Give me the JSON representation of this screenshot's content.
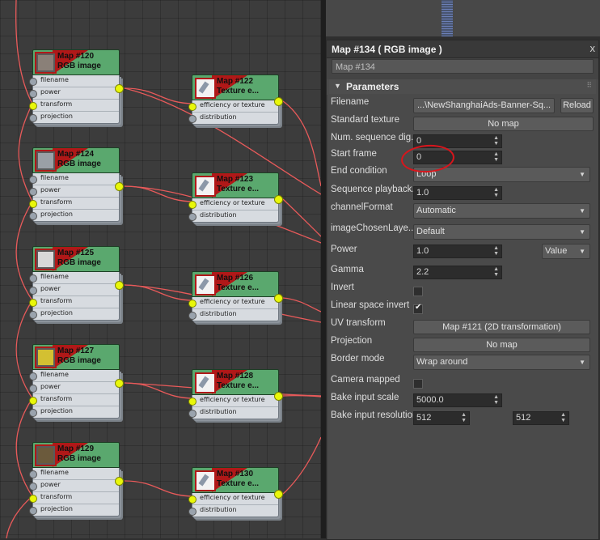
{
  "graph": {
    "nodes": [
      {
        "key": "n120",
        "title": "Map #120",
        "subtitle": "RGB image",
        "thumb": "#8a8078",
        "ports": [
          "filename",
          "power",
          "transform",
          "projection"
        ]
      },
      {
        "key": "n124",
        "title": "Map #124",
        "subtitle": "RGB image",
        "thumb": "#9aa0a6",
        "ports": [
          "filename",
          "power",
          "transform",
          "projection"
        ]
      },
      {
        "key": "n125",
        "title": "Map #125",
        "subtitle": "RGB image",
        "thumb": "#d8d8d8",
        "ports": [
          "filename",
          "power",
          "transform",
          "projection"
        ]
      },
      {
        "key": "n127",
        "title": "Map #127",
        "subtitle": "RGB image",
        "thumb": "#d3c032",
        "ports": [
          "filename",
          "power",
          "transform",
          "projection"
        ]
      },
      {
        "key": "n129",
        "title": "Map #129",
        "subtitle": "RGB image",
        "thumb": "#6b5a3c",
        "ports": [
          "filename",
          "power",
          "transform",
          "projection"
        ]
      },
      {
        "key": "n122",
        "title": "Map #122",
        "subtitle": "Texture e...",
        "ports": [
          "efficiency or texture",
          "distribution"
        ]
      },
      {
        "key": "n123",
        "title": "Map #123",
        "subtitle": "Texture e...",
        "ports": [
          "efficiency or texture",
          "distribution"
        ]
      },
      {
        "key": "n126",
        "title": "Map #126",
        "subtitle": "Texture e...",
        "ports": [
          "efficiency or texture",
          "distribution"
        ]
      },
      {
        "key": "n128",
        "title": "Map #128",
        "subtitle": "Texture e...",
        "ports": [
          "efficiency or texture",
          "distribution"
        ]
      },
      {
        "key": "n130",
        "title": "Map #130",
        "subtitle": "Texture e...",
        "ports": [
          "efficiency or texture",
          "distribution"
        ]
      }
    ],
    "wire_color": "#e85a5a"
  },
  "panel": {
    "title": "Map #134  ( RGB image )",
    "close": "x",
    "name": "Map #134",
    "rollout": "Parameters",
    "rows": {
      "filename": {
        "label": "Filename",
        "value": "...\\NewShanghaiAds-Banner-Sq...",
        "reload": "Reload"
      },
      "standard_texture": {
        "label": "Standard texture",
        "value": "No map"
      },
      "num_sequence": {
        "label": "Num. sequence dig...",
        "value": "0"
      },
      "start_frame": {
        "label": "Start frame",
        "value": "0"
      },
      "end_condition": {
        "label": "End condition",
        "value": "Loop"
      },
      "sequence_playback": {
        "label": "Sequence playback...",
        "value": "1.0"
      },
      "channel_format": {
        "label": "channelFormat",
        "value": "Automatic"
      },
      "image_chosen_layer": {
        "label": "imageChosenLaye...",
        "value": "Default"
      },
      "power": {
        "label": "Power",
        "value": "1.0",
        "mode": "Value"
      },
      "gamma": {
        "label": "Gamma",
        "value": "2.2"
      },
      "invert": {
        "label": "Invert",
        "checked": false
      },
      "linear_space_invert": {
        "label": "Linear space invert",
        "checked": true
      },
      "uv_transform": {
        "label": "UV transform",
        "value": "Map #121 (2D transformation)"
      },
      "projection": {
        "label": "Projection",
        "value": "No map"
      },
      "border_mode": {
        "label": "Border mode",
        "value": "Wrap around"
      },
      "camera_mapped": {
        "label": "Camera mapped",
        "checked": false
      },
      "bake_input_scale": {
        "label": "Bake input scale",
        "value": "5000.0"
      },
      "bake_input_resolution": {
        "label": "Bake input resolution",
        "value_x": "512",
        "value_y": "512"
      }
    }
  },
  "annotation": {
    "color": "#d9151c",
    "target": "Start frame"
  }
}
